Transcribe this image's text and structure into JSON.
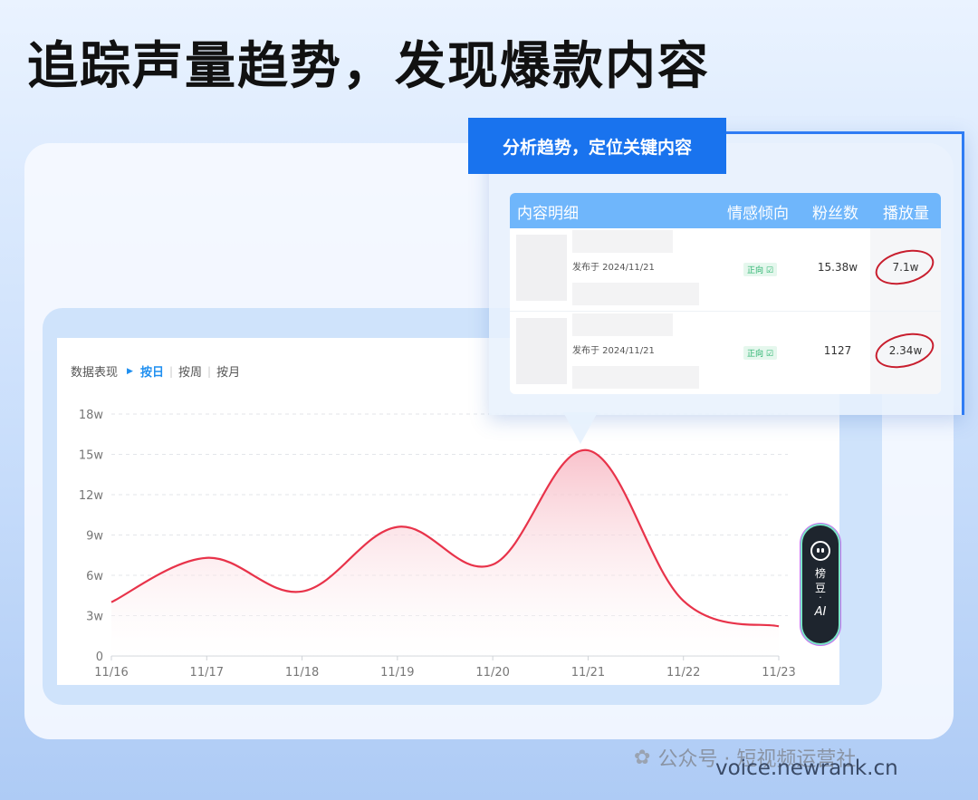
{
  "headline": "追踪声量趋势，发现爆款内容",
  "tabs": {
    "label": "数据表现",
    "active": "按日",
    "week": "按周",
    "month": "按月"
  },
  "chart_data": {
    "type": "area",
    "x": [
      "11/16",
      "11/17",
      "11/18",
      "11/19",
      "11/20",
      "11/21",
      "11/22",
      "11/23"
    ],
    "series": [
      {
        "values": [
          4.0,
          7.3,
          4.8,
          9.6,
          6.8,
          15.3,
          4.1,
          2.2
        ]
      }
    ],
    "y_ticks": [
      "0",
      "3w",
      "6w",
      "9w",
      "12w",
      "15w",
      "18w"
    ],
    "ylim": [
      0,
      18
    ],
    "unit": "w",
    "grid": true,
    "line_color": "#e8334a",
    "fill_color": "#f9d3da"
  },
  "popup": {
    "badge": "分析趋势，定位关键内容",
    "headers": {
      "content": "内容明细",
      "sentiment": "情感倾向",
      "fans": "粉丝数",
      "plays": "播放量"
    },
    "rows": [
      {
        "published": "发布于 2024/11/21",
        "sentiment": "正向",
        "fans": "15.38w",
        "plays": "7.1w"
      },
      {
        "published": "发布于 2024/11/21",
        "sentiment": "正向",
        "fans": "1127",
        "plays": "2.34w"
      }
    ]
  },
  "ai": {
    "char1": "榜",
    "char2": "豆",
    "dot": "·",
    "label": "AI"
  },
  "watermark": {
    "text": "公众号 · 短视频运营社",
    "url": "voice.newrank.cn"
  },
  "colors": {
    "accent": "#1973ee",
    "header": "#6fb6fb",
    "positive": "#27b26c",
    "highlight_circle": "#c81e2e"
  }
}
